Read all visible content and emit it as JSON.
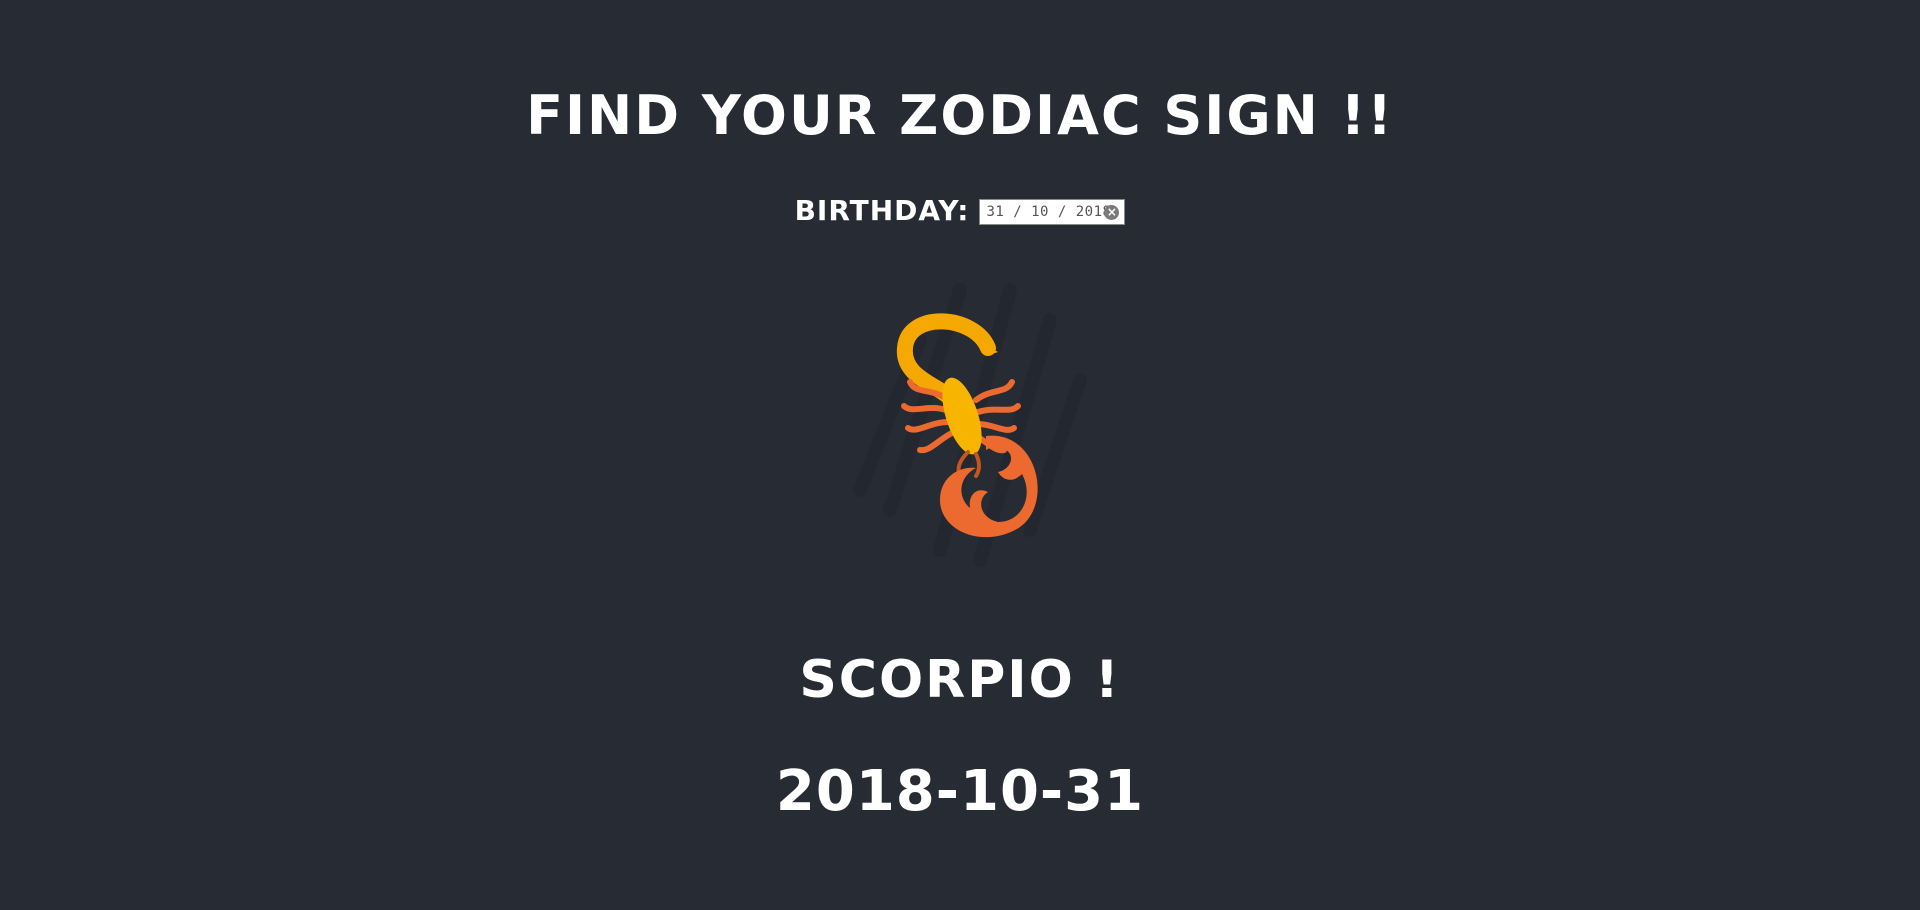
{
  "header": {
    "title": "FIND YOUR ZODIAC SIGN !!"
  },
  "birthday": {
    "label": "BIRTHDAY:",
    "value": "31 / 10 / 2018",
    "clear_icon": "clear-icon"
  },
  "sign_image": {
    "icon": "scorpion-icon"
  },
  "result": {
    "sign": "SCORPIO !",
    "date": "2018-10-31"
  },
  "colors": {
    "background": "#272b33",
    "text": "#ffffff",
    "scorpion_yellow": "#f7b500",
    "scorpion_orange": "#ec6a2f"
  }
}
